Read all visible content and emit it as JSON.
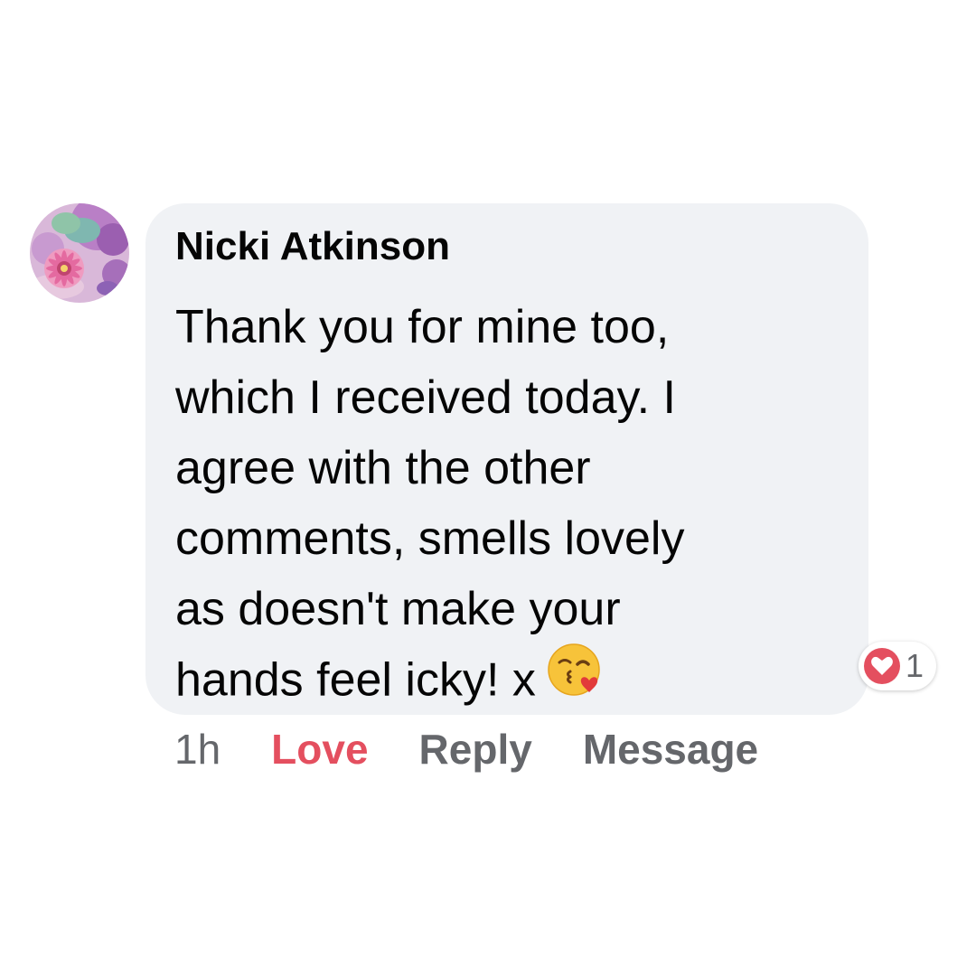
{
  "comment": {
    "author": "Nicki Atkinson",
    "lines": [
      "Thank you for mine too,",
      "which I received today. I",
      "agree with the other",
      "comments, smells lovely",
      "as doesn't make your",
      "hands feel icky! x"
    ],
    "emoji_icon": "face-blowing-a-kiss-icon",
    "avatar_icon": "floral-avatar-icon"
  },
  "reactions": {
    "icon": "heart-icon",
    "count": "1",
    "color": "#e44f5f"
  },
  "actions": {
    "time": "1h",
    "love": "Love",
    "reply": "Reply",
    "message": "Message"
  },
  "colors": {
    "bubble": "#f0f2f5",
    "love_active": "#e44f5f",
    "secondary_text": "#65676b"
  }
}
